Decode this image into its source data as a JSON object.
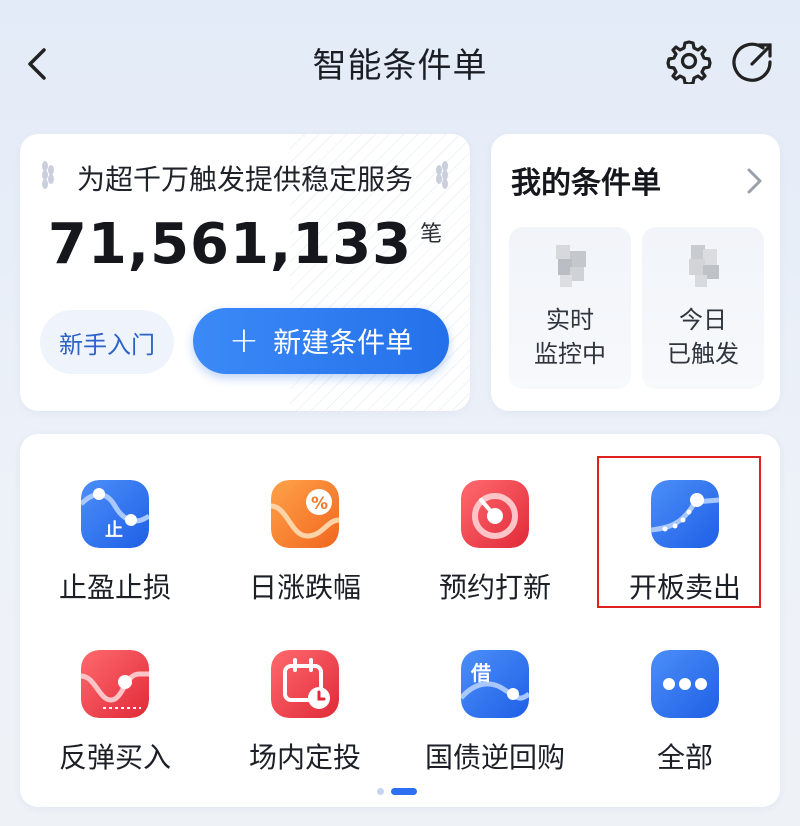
{
  "header": {
    "title": "智能条件单",
    "back_icon": "chevron-left-icon",
    "settings_icon": "gear-icon",
    "share_icon": "share-icon"
  },
  "stats_card": {
    "tagline": "为超千万触发提供稳定服务",
    "count": "71,561,133",
    "unit": "笔",
    "newbie_label": "新手入门",
    "create_label": "新建条件单",
    "create_icon": "plus-icon",
    "accent": "#2a76ee"
  },
  "my_orders": {
    "title": "我的条件单",
    "items": [
      {
        "line1": "实时",
        "line2": "监控中"
      },
      {
        "line1": "今日",
        "line2": "已触发"
      }
    ]
  },
  "tools": [
    {
      "label": "止盈止损",
      "icon": "stop-profit-loss-icon",
      "badge": "止",
      "color": "#2f6ff0"
    },
    {
      "label": "日涨跌幅",
      "icon": "daily-change-percent-icon",
      "badge": "%",
      "color": "#f07a2c"
    },
    {
      "label": "预约打新",
      "icon": "ipo-reservation-icon",
      "color": "#ec3b46"
    },
    {
      "label": "开板卖出",
      "icon": "board-open-sell-icon",
      "color": "#2f6ff0"
    },
    {
      "label": "反弹买入",
      "icon": "rebound-buy-icon",
      "color": "#ec3b46"
    },
    {
      "label": "场内定投",
      "icon": "calendar-invest-icon",
      "color": "#ec3b46"
    },
    {
      "label": "国债逆回购",
      "icon": "bond-repo-icon",
      "badge": "借",
      "color": "#2f6ff0"
    },
    {
      "label": "全部",
      "icon": "more-icon",
      "color": "#2f6ff0"
    }
  ],
  "pager": {
    "page": 2,
    "total": 2
  }
}
